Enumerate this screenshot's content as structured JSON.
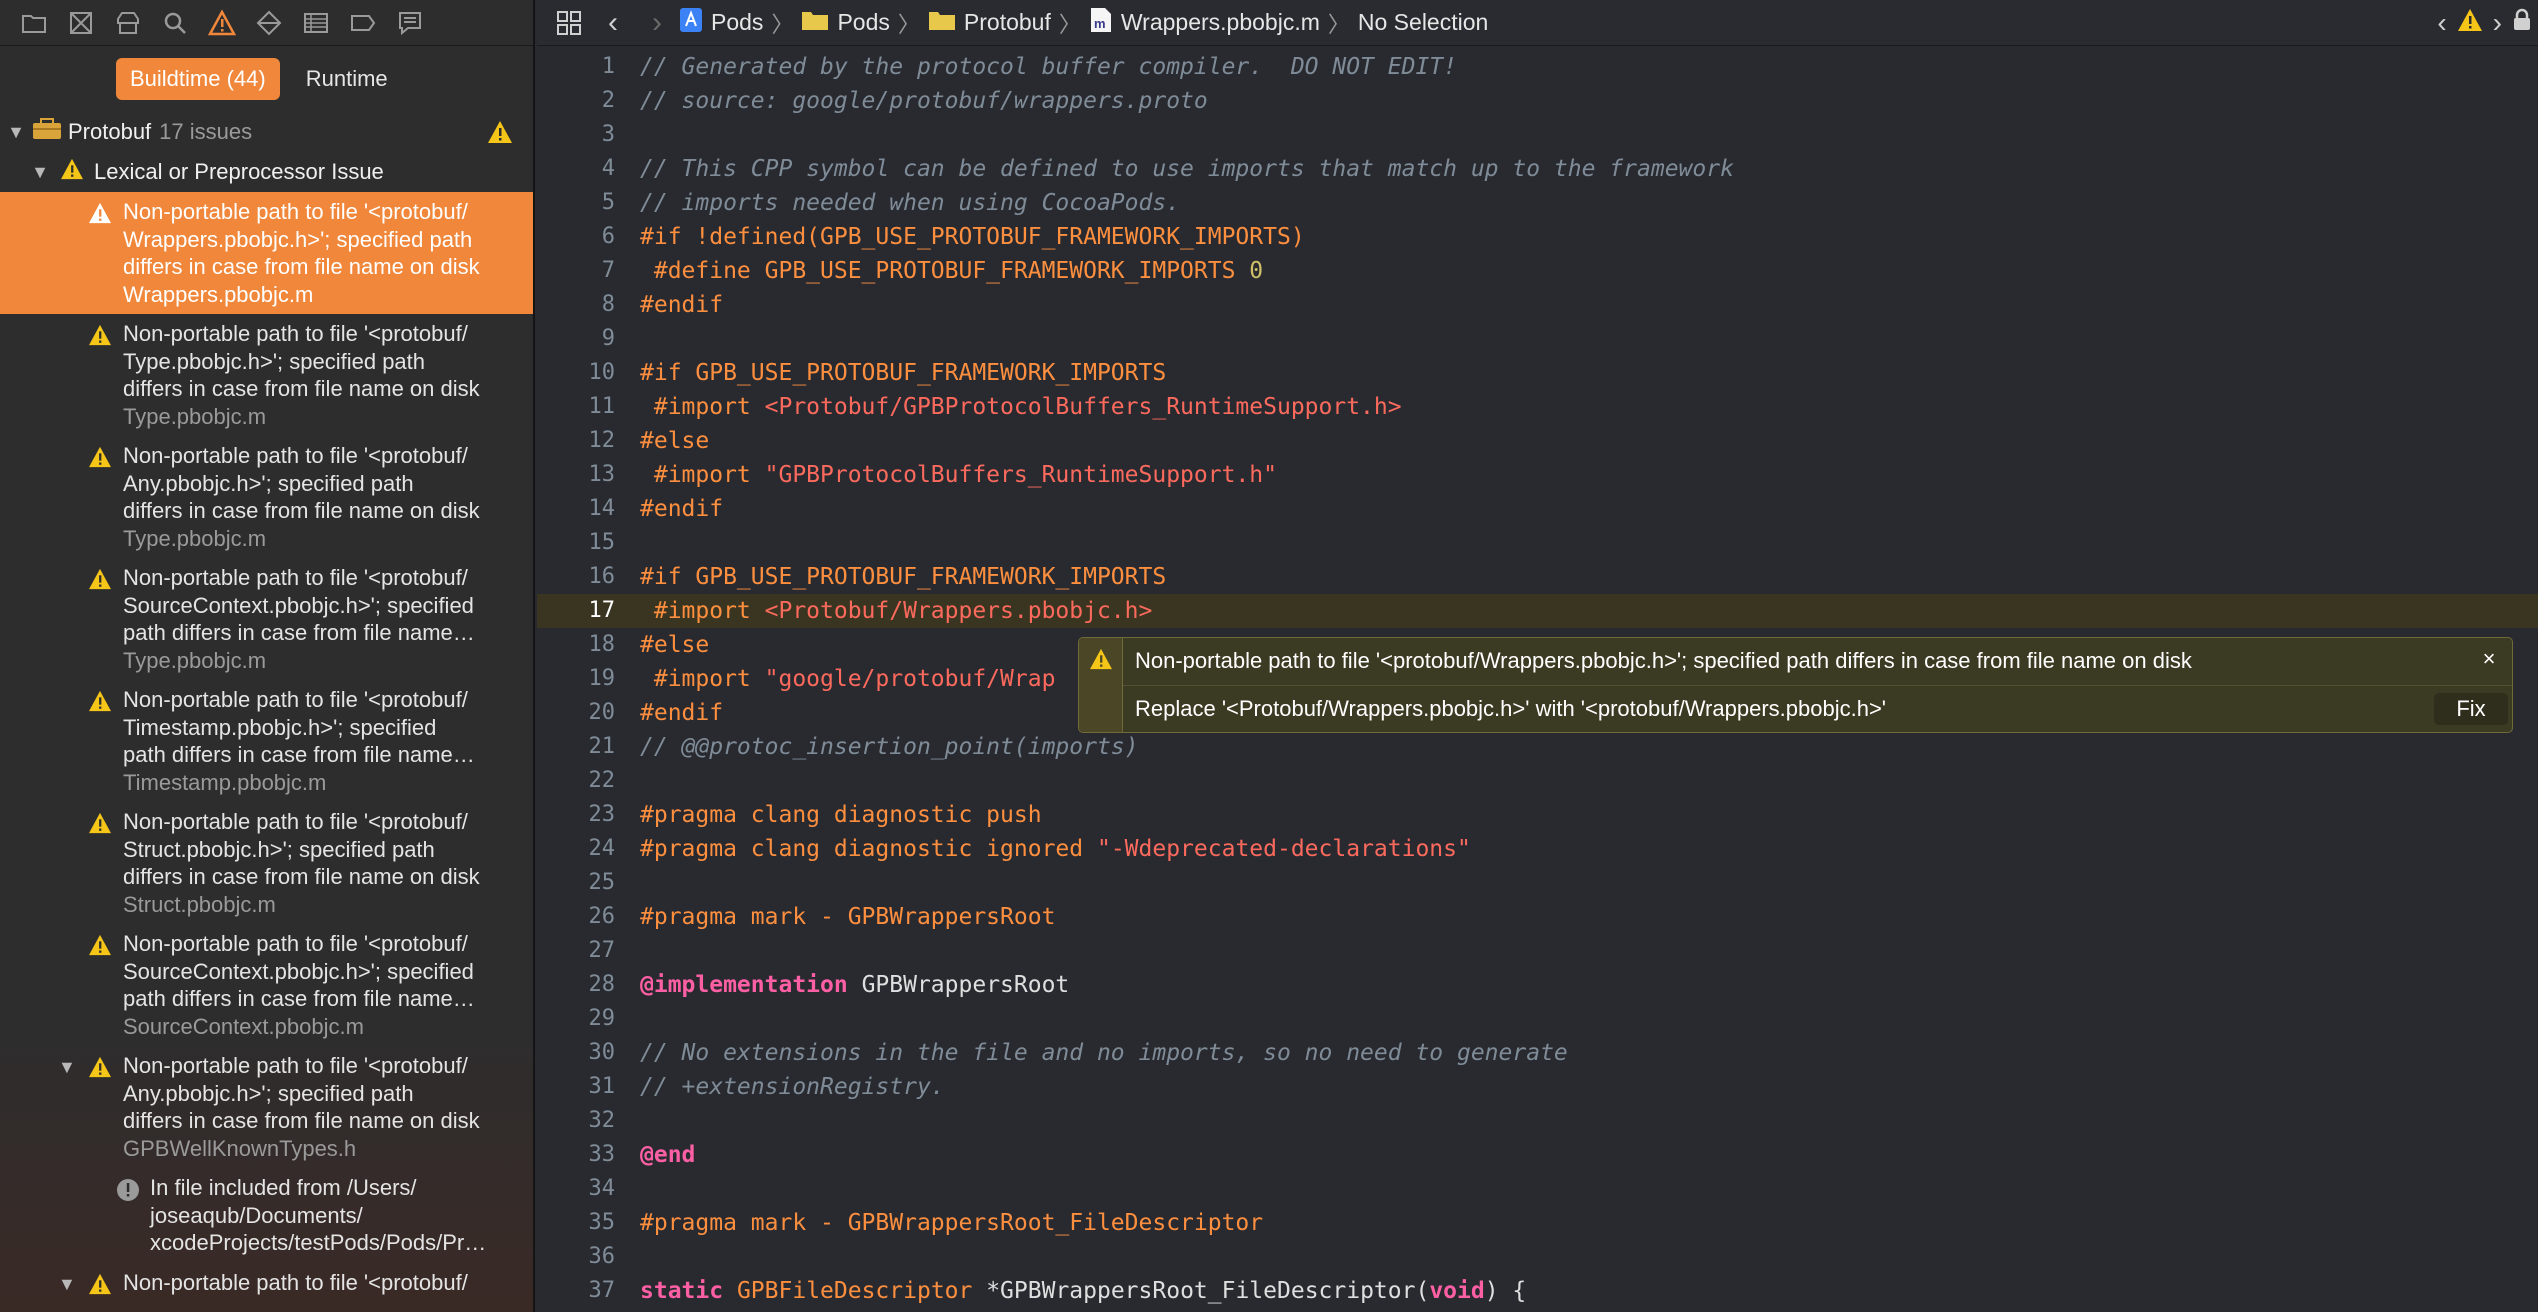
{
  "navigator": {
    "scope_tabs": [
      {
        "label": "Buildtime (44)",
        "active": true
      },
      {
        "label": "Runtime",
        "active": false
      }
    ],
    "project": {
      "name": "Protobuf",
      "count": "17 issues"
    },
    "category": "Lexical or Preprocessor Issue",
    "issues": [
      {
        "lines": [
          "Non-portable path to file '<protobuf/",
          "Wrappers.pbobjc.h>'; specified path",
          "differs in case from file name on disk"
        ],
        "file": "Wrappers.pbobjc.m",
        "selected": true
      },
      {
        "lines": [
          "Non-portable path to file '<protobuf/",
          "Type.pbobjc.h>'; specified path",
          "differs in case from file name on disk"
        ],
        "file": "Type.pbobjc.m"
      },
      {
        "lines": [
          "Non-portable path to file '<protobuf/",
          "Any.pbobjc.h>'; specified path",
          "differs in case from file name on disk"
        ],
        "file": "Type.pbobjc.m"
      },
      {
        "lines": [
          "Non-portable path to file '<protobuf/",
          "SourceContext.pbobjc.h>'; specified",
          "path differs in case from file name…"
        ],
        "file": "Type.pbobjc.m"
      },
      {
        "lines": [
          "Non-portable path to file '<protobuf/",
          "Timestamp.pbobjc.h>'; specified",
          "path differs in case from file name…"
        ],
        "file": "Timestamp.pbobjc.m"
      },
      {
        "lines": [
          "Non-portable path to file '<protobuf/",
          "Struct.pbobjc.h>'; specified path",
          "differs in case from file name on disk"
        ],
        "file": "Struct.pbobjc.m"
      },
      {
        "lines": [
          "Non-portable path to file '<protobuf/",
          "SourceContext.pbobjc.h>'; specified",
          "path differs in case from file name…"
        ],
        "file": "SourceContext.pbobjc.m"
      },
      {
        "lines": [
          "Non-portable path to file '<protobuf/",
          "Any.pbobjc.h>'; specified path",
          "differs in case from file name on disk"
        ],
        "file": "GPBWellKnownTypes.h",
        "expanded": true
      }
    ],
    "note": {
      "lines": [
        "In file included from /Users/",
        "joseaqub/Documents/",
        "xcodeProjects/testPods/Pods/Pr…"
      ]
    },
    "last_issue": "Non-portable path to file '<protobuf/"
  },
  "jumpbar": {
    "crumbs": [
      "Pods",
      "Pods",
      "Protobuf",
      "Wrappers.pbobjc.m",
      "No Selection"
    ]
  },
  "editor": {
    "current_line": 17,
    "lines": [
      {
        "n": "1",
        "parts": [
          [
            "c-com",
            "// Generated by the protocol buffer compiler.  DO NOT EDIT!"
          ]
        ]
      },
      {
        "n": "2",
        "parts": [
          [
            "c-com",
            "// source: google/protobuf/wrappers.proto"
          ]
        ]
      },
      {
        "n": "3",
        "parts": []
      },
      {
        "n": "4",
        "parts": [
          [
            "c-com",
            "// This CPP symbol can be defined to use imports that match up to the framework"
          ]
        ]
      },
      {
        "n": "5",
        "parts": [
          [
            "c-com",
            "// imports needed when using CocoaPods."
          ]
        ]
      },
      {
        "n": "6",
        "parts": [
          [
            "c-pp",
            "#if !defined(GPB_USE_PROTOBUF_FRAMEWORK_IMPORTS)"
          ]
        ]
      },
      {
        "n": "7",
        "parts": [
          [
            "c-pp",
            " #define GPB_USE_PROTOBUF_FRAMEWORK_IMPORTS "
          ],
          [
            "c-num",
            "0"
          ]
        ]
      },
      {
        "n": "8",
        "parts": [
          [
            "c-pp",
            "#endif"
          ]
        ]
      },
      {
        "n": "9",
        "parts": []
      },
      {
        "n": "10",
        "parts": [
          [
            "c-pp",
            "#if GPB_USE_PROTOBUF_FRAMEWORK_IMPORTS"
          ]
        ]
      },
      {
        "n": "11",
        "parts": [
          [
            "c-pp",
            " #import "
          ],
          [
            "c-str",
            "<Protobuf/GPBProtocolBuffers_RuntimeSupport.h>"
          ]
        ]
      },
      {
        "n": "12",
        "parts": [
          [
            "c-pp",
            "#else"
          ]
        ]
      },
      {
        "n": "13",
        "parts": [
          [
            "c-pp",
            " #import "
          ],
          [
            "c-str",
            "\"GPBProtocolBuffers_RuntimeSupport.h\""
          ]
        ]
      },
      {
        "n": "14",
        "parts": [
          [
            "c-pp",
            "#endif"
          ]
        ]
      },
      {
        "n": "15",
        "parts": []
      },
      {
        "n": "16",
        "parts": [
          [
            "c-pp",
            "#if GPB_USE_PROTOBUF_FRAMEWORK_IMPORTS"
          ]
        ]
      },
      {
        "n": "17",
        "parts": [
          [
            "c-pp",
            " #import "
          ],
          [
            "c-str",
            "<Protobuf/Wrappers.pbobjc.h>"
          ]
        ]
      },
      {
        "n": "18",
        "parts": [
          [
            "c-pp",
            "#else"
          ]
        ]
      },
      {
        "n": "19",
        "parts": [
          [
            "c-pp",
            " #import "
          ],
          [
            "c-str",
            "\"google/protobuf/Wrap"
          ]
        ]
      },
      {
        "n": "20",
        "parts": [
          [
            "c-pp",
            "#endif"
          ]
        ]
      },
      {
        "n": "21",
        "parts": [
          [
            "c-com",
            "// @@protoc_insertion_point(imports)"
          ]
        ]
      },
      {
        "n": "22",
        "parts": []
      },
      {
        "n": "23",
        "parts": [
          [
            "c-pp",
            "#pragma clang diagnostic push"
          ]
        ]
      },
      {
        "n": "24",
        "parts": [
          [
            "c-pp",
            "#pragma clang diagnostic ignored "
          ],
          [
            "c-str",
            "\"-Wdeprecated-declarations\""
          ]
        ]
      },
      {
        "n": "25",
        "parts": []
      },
      {
        "n": "26",
        "parts": [
          [
            "c-pp",
            "#pragma mark - GPBWrappersRoot"
          ]
        ]
      },
      {
        "n": "27",
        "parts": []
      },
      {
        "n": "28",
        "parts": [
          [
            "c-kw",
            "@implementation"
          ],
          [
            "c-plain",
            " GPBWrappersRoot"
          ]
        ]
      },
      {
        "n": "29",
        "parts": []
      },
      {
        "n": "30",
        "parts": [
          [
            "c-com",
            "// No extensions in the file and no imports, so no need to generate"
          ]
        ]
      },
      {
        "n": "31",
        "parts": [
          [
            "c-com",
            "// +extensionRegistry."
          ]
        ]
      },
      {
        "n": "32",
        "parts": []
      },
      {
        "n": "33",
        "parts": [
          [
            "c-kw",
            "@end"
          ]
        ]
      },
      {
        "n": "34",
        "parts": []
      },
      {
        "n": "35",
        "parts": [
          [
            "c-pp",
            "#pragma mark - GPBWrappersRoot_FileDescriptor"
          ]
        ]
      },
      {
        "n": "36",
        "parts": []
      },
      {
        "n": "37",
        "parts": [
          [
            "c-kw",
            "static"
          ],
          [
            "c-plain",
            " "
          ],
          [
            "c-pp",
            "GPBFileDescriptor"
          ],
          [
            "c-plain",
            " *GPBWrappersRoot_FileDescriptor("
          ],
          [
            "c-kw",
            "void"
          ],
          [
            "c-plain",
            ") {"
          ]
        ]
      }
    ]
  },
  "fixit": {
    "message": "Non-portable path to file '<protobuf/Wrappers.pbobjc.h>'; specified path differs in case from file name on disk",
    "replacement": "Replace '<Protobuf/Wrappers.pbobjc.h>' with '<protobuf/Wrappers.pbobjc.h>'",
    "fix_label": "Fix",
    "close_label": "×"
  },
  "colors": {
    "accent": "#f0873a",
    "warning": "#f5c518",
    "editor_bg": "#292a30"
  }
}
